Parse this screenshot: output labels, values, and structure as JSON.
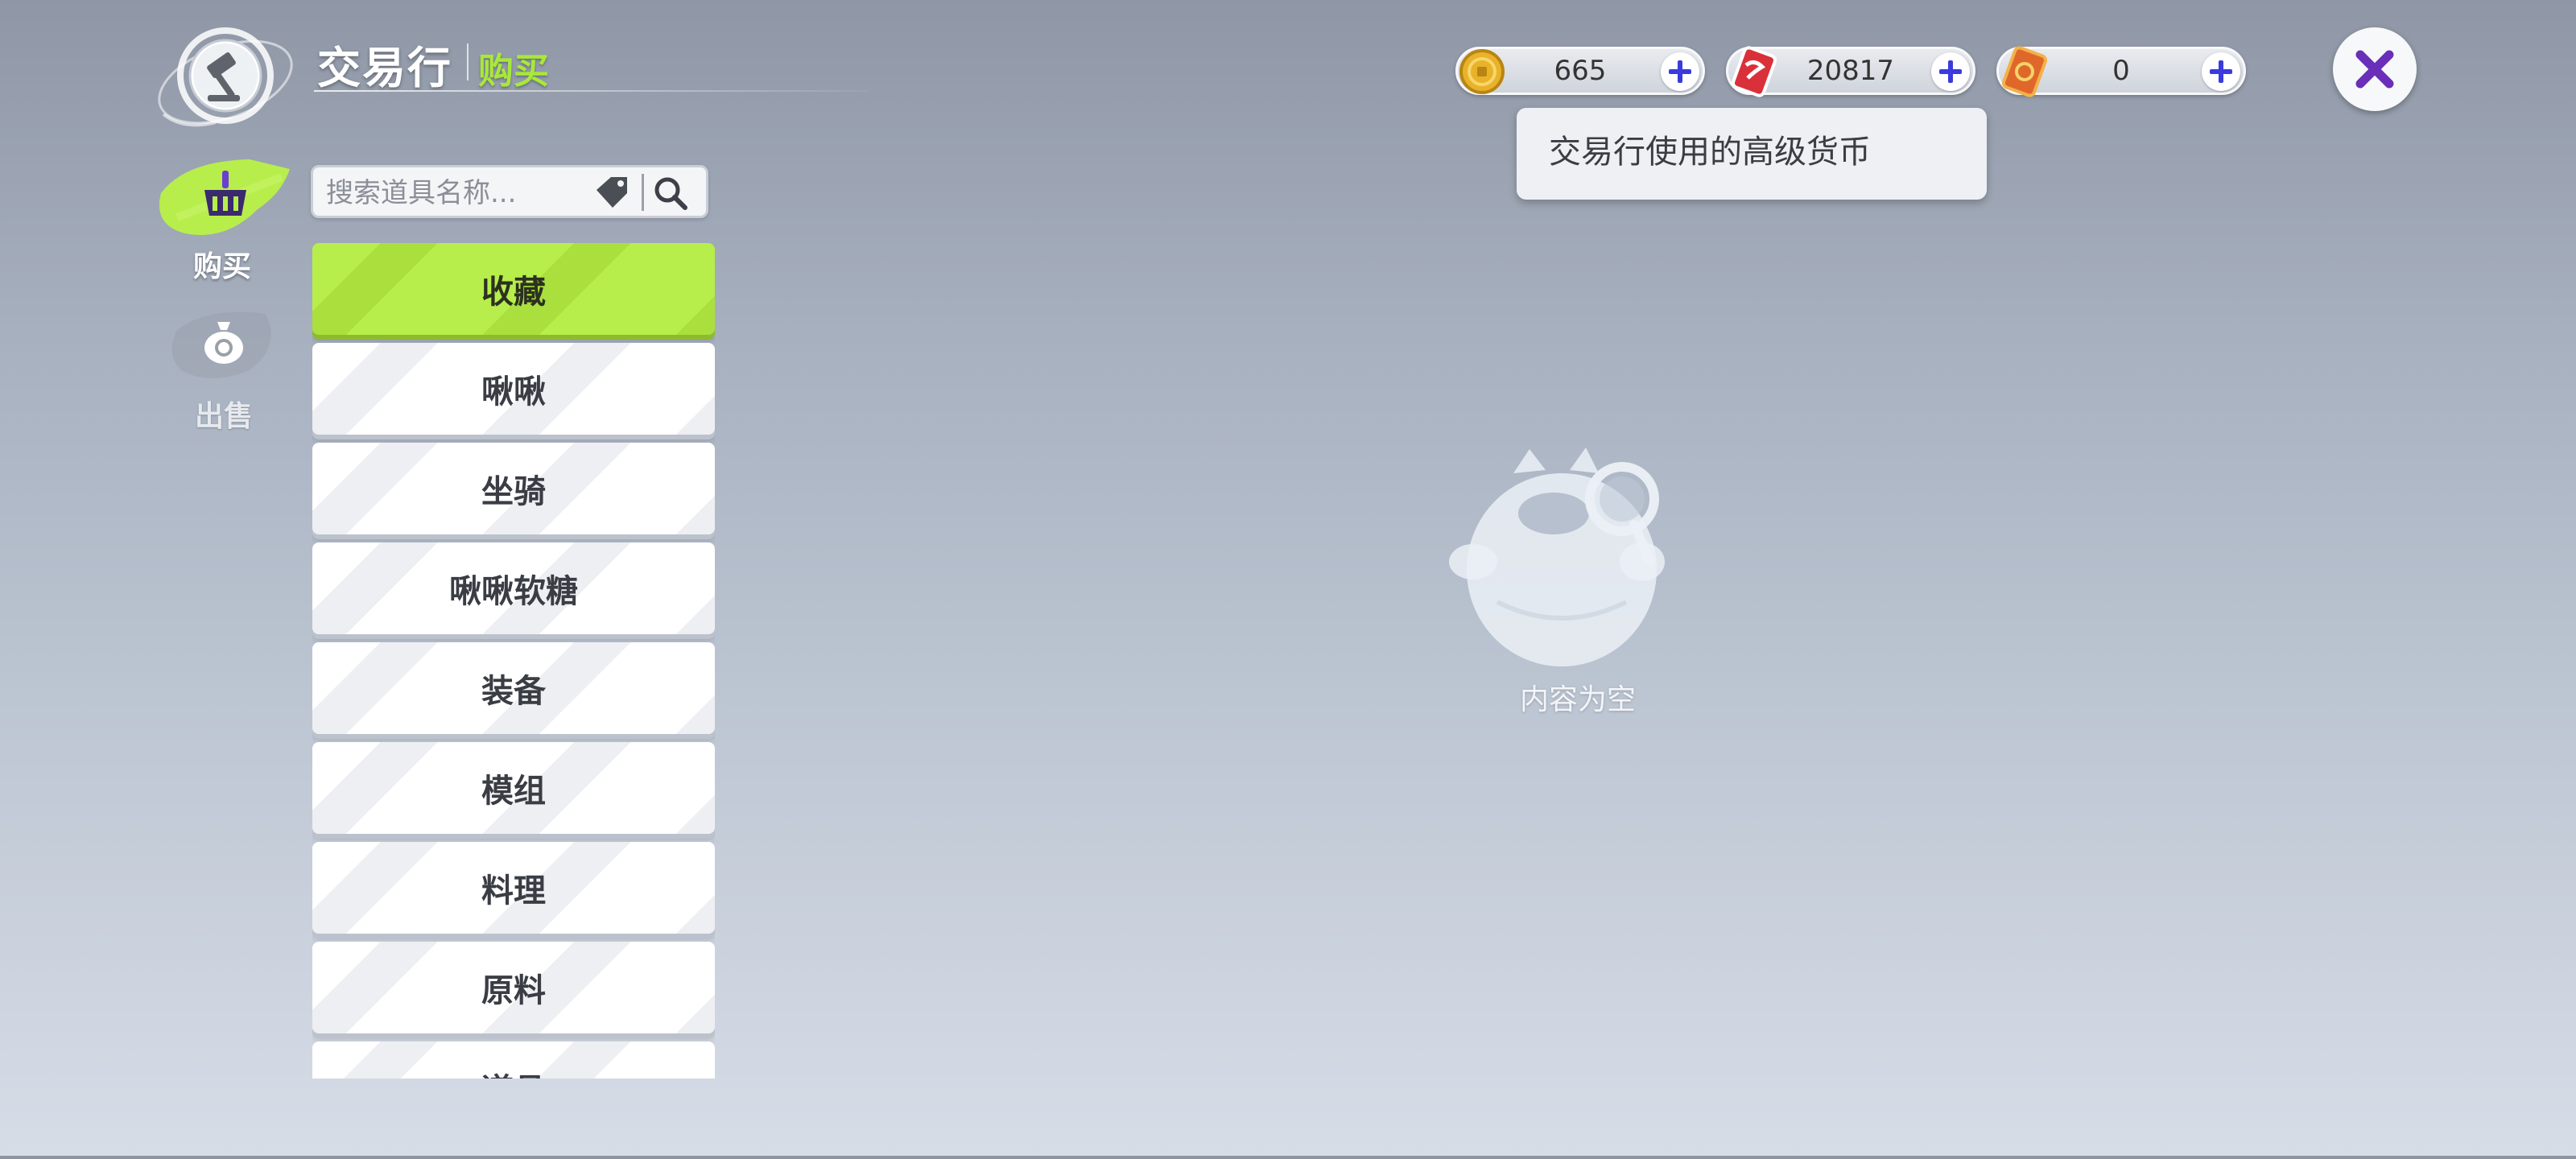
{
  "header": {
    "title": "交易行",
    "subtitle": "购买"
  },
  "nav": {
    "buy_label": "购买",
    "sell_label": "出售"
  },
  "search": {
    "placeholder": "搜索道具名称..."
  },
  "categories": [
    {
      "label": "收藏",
      "active": true
    },
    {
      "label": "啾啾"
    },
    {
      "label": "坐骑"
    },
    {
      "label": "啾啾软糖"
    },
    {
      "label": "装备"
    },
    {
      "label": "模组"
    },
    {
      "label": "料理"
    },
    {
      "label": "原料"
    },
    {
      "label": "道具"
    }
  ],
  "currencies": [
    {
      "value": "665",
      "icon": "gold-coin-icon",
      "color": "#e8b22a"
    },
    {
      "value": "20817",
      "icon": "red-ticket-icon",
      "color": "#d9303a"
    },
    {
      "value": "0",
      "icon": "orange-ticket-icon",
      "color": "#e0672a"
    }
  ],
  "tooltip": {
    "text": "交易行使用的高级货币"
  },
  "empty_state": {
    "text": "内容为空"
  },
  "colors": {
    "accent": "#b7ee4c",
    "accent_text": "#a8e83a",
    "plus": "#3a3adf",
    "close_x": "#6a2fb8"
  }
}
